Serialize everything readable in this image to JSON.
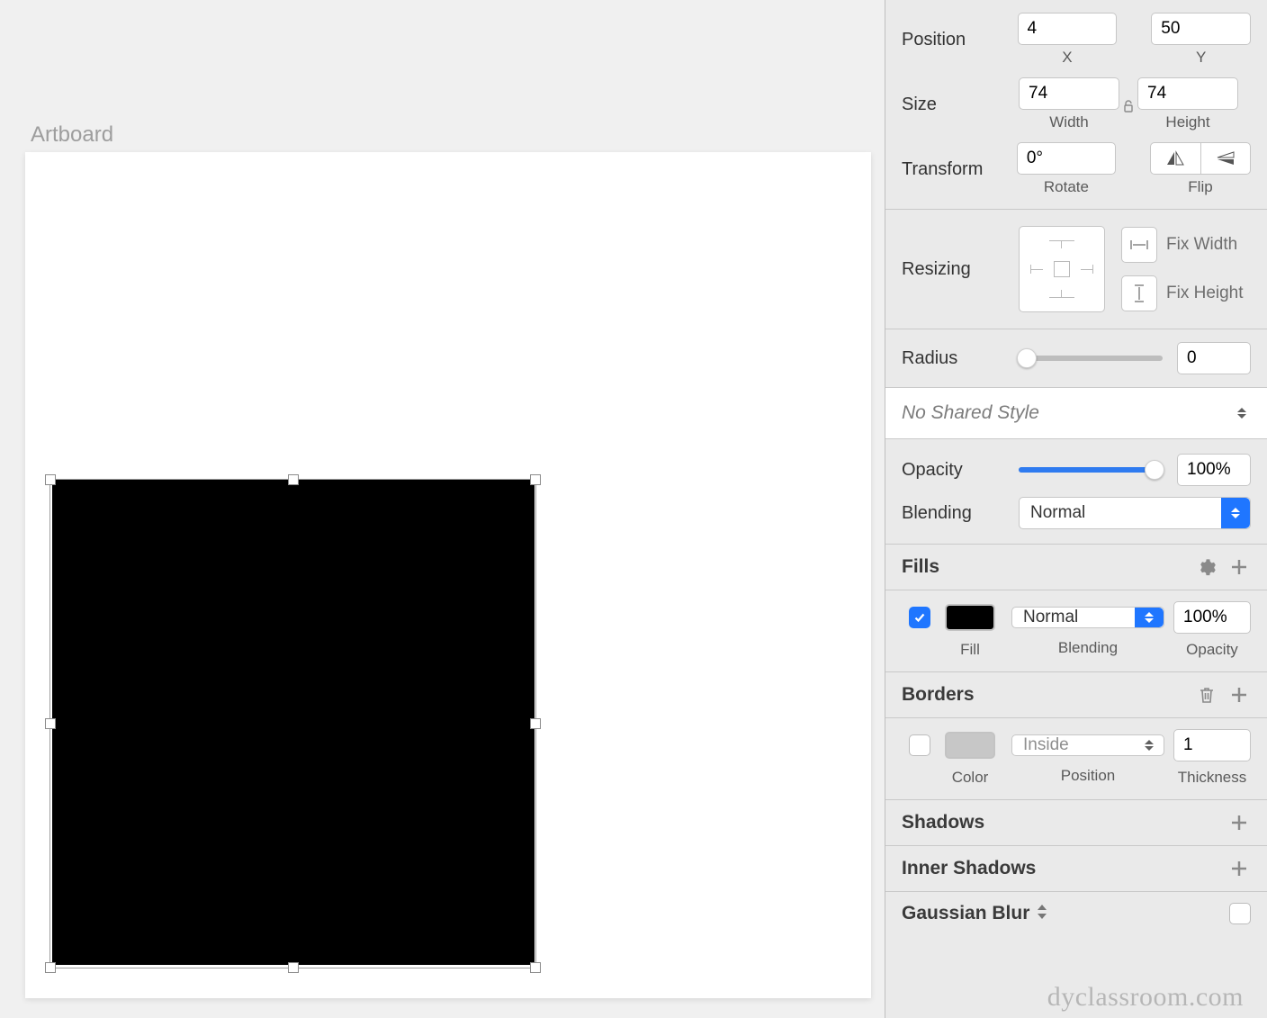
{
  "canvas": {
    "artboard_label": "Artboard"
  },
  "inspector": {
    "position": {
      "label": "Position",
      "x_value": "4",
      "x_label": "X",
      "y_value": "50",
      "y_label": "Y"
    },
    "size": {
      "label": "Size",
      "w_value": "74",
      "w_label": "Width",
      "h_value": "74",
      "h_label": "Height"
    },
    "transform": {
      "label": "Transform",
      "rotate_value": "0°",
      "rotate_label": "Rotate",
      "flip_label": "Flip"
    },
    "resizing": {
      "label": "Resizing",
      "fix_width_label": "Fix Width",
      "fix_height_label": "Fix Height"
    },
    "radius": {
      "label": "Radius",
      "value": "0"
    },
    "shared_style": {
      "text": "No Shared Style"
    },
    "opacity": {
      "label": "Opacity",
      "value": "100%"
    },
    "blending": {
      "label": "Blending",
      "value": "Normal"
    },
    "fills": {
      "header": "Fills",
      "checked": true,
      "fill_color": "#000000",
      "fill_label": "Fill",
      "blend_value": "Normal",
      "blend_label": "Blending",
      "opacity_value": "100%",
      "opacity_label": "Opacity"
    },
    "borders": {
      "header": "Borders",
      "checked": false,
      "color": "#c7c7c7",
      "color_label": "Color",
      "position_value": "Inside",
      "position_label": "Position",
      "thickness_value": "1",
      "thickness_label": "Thickness"
    },
    "shadows": {
      "header": "Shadows"
    },
    "inner_shadows": {
      "header": "Inner Shadows"
    },
    "gaussian_blur": {
      "header": "Gaussian Blur"
    }
  },
  "watermark": "dyclassroom.com"
}
